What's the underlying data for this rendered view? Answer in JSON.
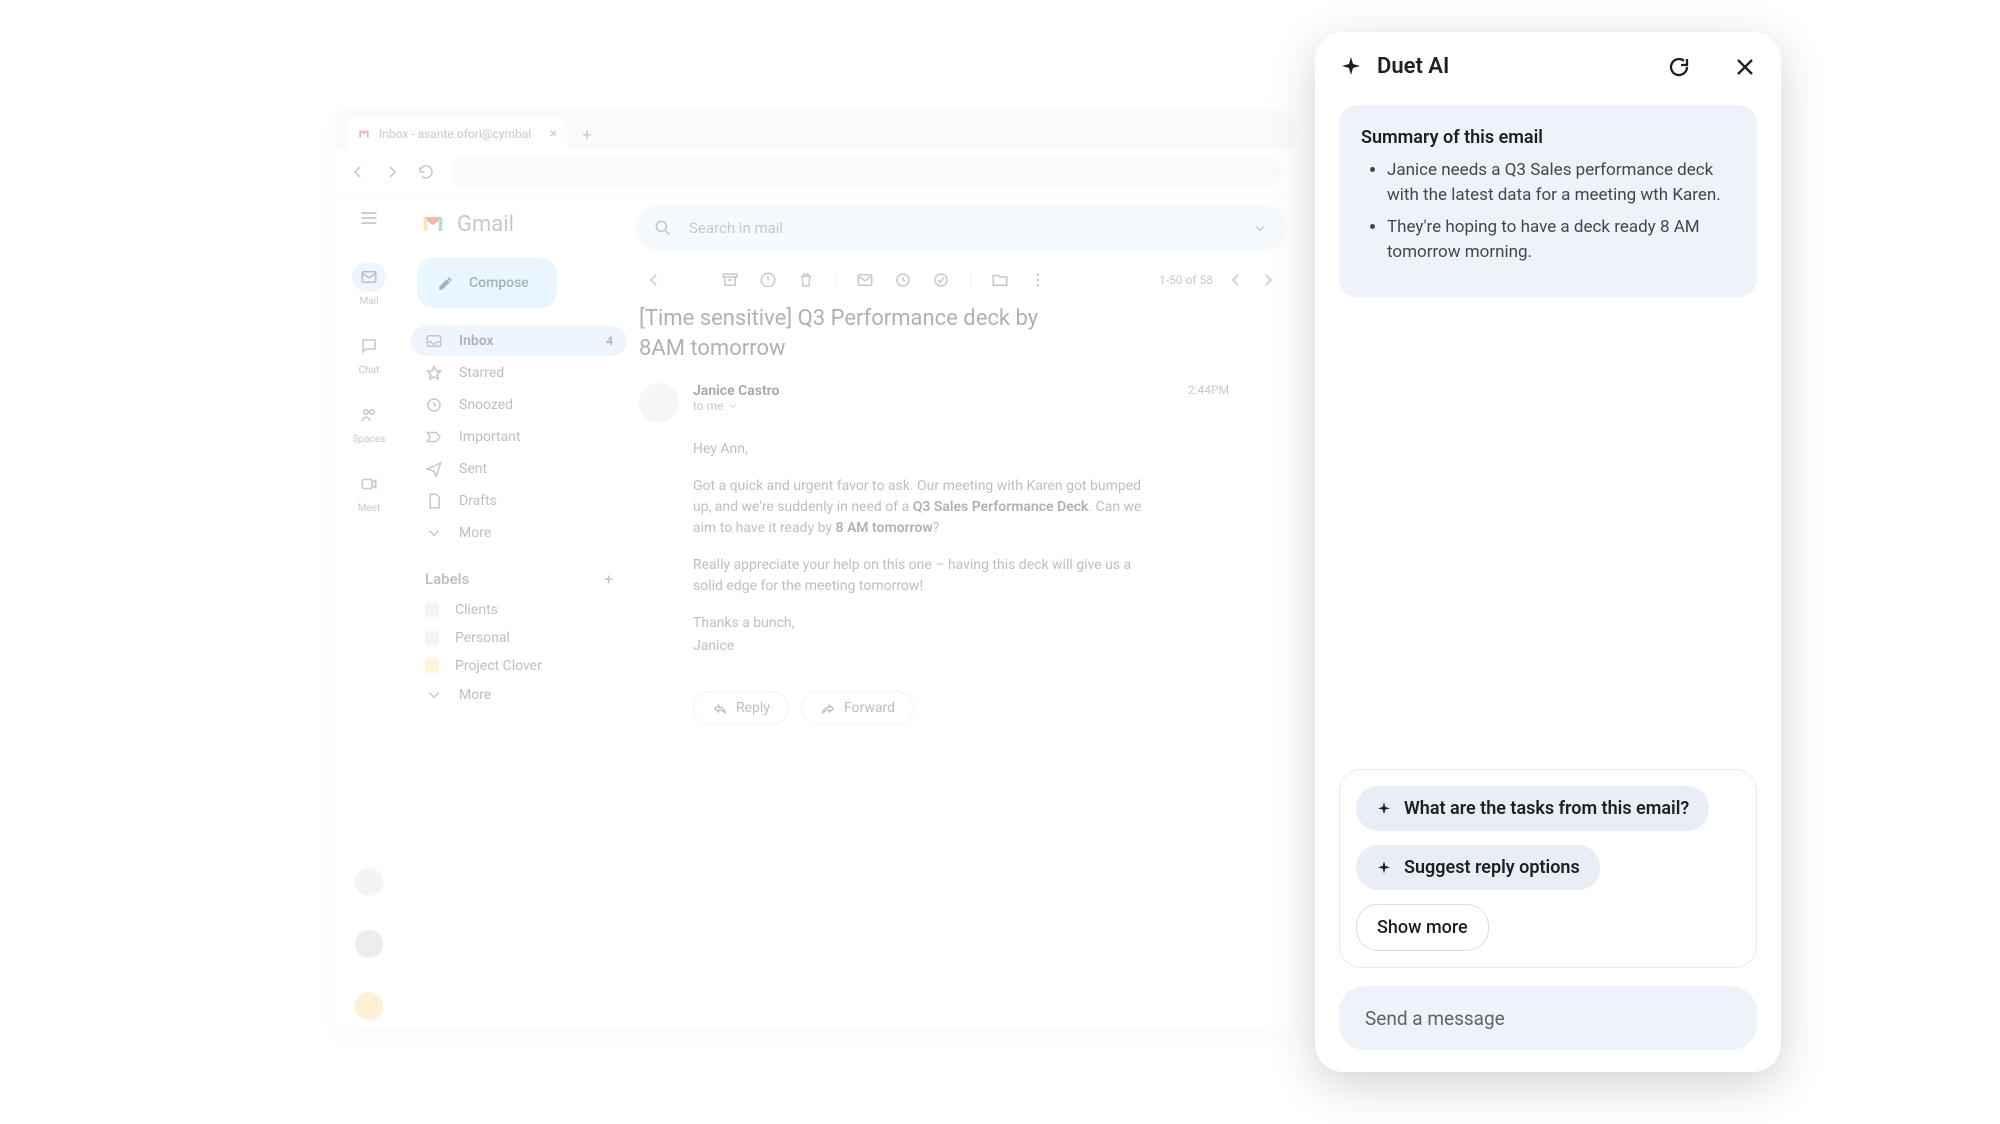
{
  "browser": {
    "tab_title": "Inbox - asante.ofori@cymbal"
  },
  "rail": {
    "items": [
      "Mail",
      "Chat",
      "Spaces",
      "Meet"
    ]
  },
  "brand": "Gmail",
  "compose_label": "Compose",
  "search_placeholder": "Search in mail",
  "folders": [
    {
      "label": "Inbox",
      "count": "4",
      "active": true,
      "icon": "inbox"
    },
    {
      "label": "Starred",
      "icon": "star"
    },
    {
      "label": "Snoozed",
      "icon": "clock"
    },
    {
      "label": "Important",
      "icon": "important"
    },
    {
      "label": "Sent",
      "icon": "send"
    },
    {
      "label": "Drafts",
      "icon": "file"
    },
    {
      "label": "More",
      "icon": "chevron"
    }
  ],
  "labels_header": "Labels",
  "labels": [
    {
      "label": "Clients",
      "color": "#dfe1e5"
    },
    {
      "label": "Personal",
      "color": "#dfe1e5"
    },
    {
      "label": "Project Clover",
      "color": "#fde293"
    },
    {
      "label": "More",
      "color": null
    }
  ],
  "pager_text": "1-50 of 58",
  "subject": "[Time sensitive] Q3 Performance deck by 8AM tomorrow",
  "message": {
    "sender": "Janice Castro",
    "recipient": "to me",
    "time": "2:44PM",
    "greeting": "Hey Ann,",
    "p1a": "Got a quick and urgent favor to ask. Our meeting with Karen got bumped up, and we're suddenly in need of a ",
    "p1_bold1": "Q3 Sales Performance Deck",
    "p1b": ". Can we aim to have it ready by ",
    "p1_bold2": "8 AM tomorrow",
    "p1c": "?",
    "p2": "Really appreciate your help on this one – having this deck will give us a solid edge for the meeting tomorrow!",
    "signoff1": "Thanks a bunch,",
    "signoff2": "Janice"
  },
  "reply_label": "Reply",
  "forward_label": "Forward",
  "duet": {
    "title": "Duet AI",
    "summary_title": "Summary of this email",
    "bullets": [
      "Janice needs a Q3 Sales performance deck with the latest data for a meeting wth Karen.",
      "They're hoping to have a deck ready 8 AM tomorrow morning."
    ],
    "suggestions": [
      "What are the tasks from this email?",
      "Suggest reply options"
    ],
    "show_more": "Show more",
    "composer_placeholder": "Send a message"
  }
}
